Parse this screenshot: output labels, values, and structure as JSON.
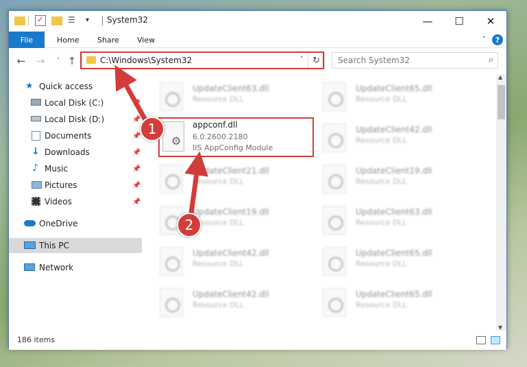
{
  "window": {
    "title": "System32"
  },
  "ribbon": {
    "tabs": [
      "File",
      "Home",
      "Share",
      "View"
    ],
    "help_label": "?"
  },
  "address": {
    "path": "C:\\Windows\\System32",
    "search_placeholder": "Search System32"
  },
  "sidebar": {
    "items": [
      {
        "label": "Quick access",
        "icon": "star-icon"
      },
      {
        "label": "Local Disk (C:)",
        "icon": "drive-icon"
      },
      {
        "label": "Local Disk (D:)",
        "icon": "drive-icon"
      },
      {
        "label": "Documents",
        "icon": "documents-icon"
      },
      {
        "label": "Downloads",
        "icon": "downloads-icon"
      },
      {
        "label": "Music",
        "icon": "music-icon"
      },
      {
        "label": "Pictures",
        "icon": "pictures-icon"
      },
      {
        "label": "Videos",
        "icon": "videos-icon"
      },
      {
        "label": "OneDrive",
        "icon": "cloud-icon"
      },
      {
        "label": "This PC",
        "icon": "computer-icon"
      },
      {
        "label": "Network",
        "icon": "network-icon"
      }
    ]
  },
  "files": {
    "left": [
      {
        "name": "UpdateClient63.dll",
        "desc": "Resource DLL"
      },
      {
        "name": "UpdateClient21.dll",
        "desc": "Resource DLL"
      },
      {
        "name": "UpdateClient19.dll",
        "desc": "Resource DLL"
      },
      {
        "name": "UpdateClient42.dll",
        "desc": "Resource DLL"
      },
      {
        "name": "UpdateClient42.dll",
        "desc": "Resource DLL"
      }
    ],
    "right": [
      {
        "name": "UpdateClient65.dll",
        "desc": "Resource DLL"
      },
      {
        "name": "UpdateClient42.dll",
        "desc": "Resource DLL"
      },
      {
        "name": "UpdateClient19.dll",
        "desc": "Resource DLL"
      },
      {
        "name": "UpdateClient63.dll",
        "desc": "Resource DLL"
      },
      {
        "name": "UpdateClient65.dll",
        "desc": "Resource DLL"
      },
      {
        "name": "UpdateClient65.dll",
        "desc": "Resource DLL"
      }
    ],
    "selected": {
      "name": "appconf.dll",
      "version": "6.0.2600.2180",
      "description": "IIS AppConfig Module"
    }
  },
  "status": {
    "item_count": "186 items"
  },
  "annotations": {
    "step1": "1",
    "step2": "2",
    "color": "#d23c3a"
  }
}
